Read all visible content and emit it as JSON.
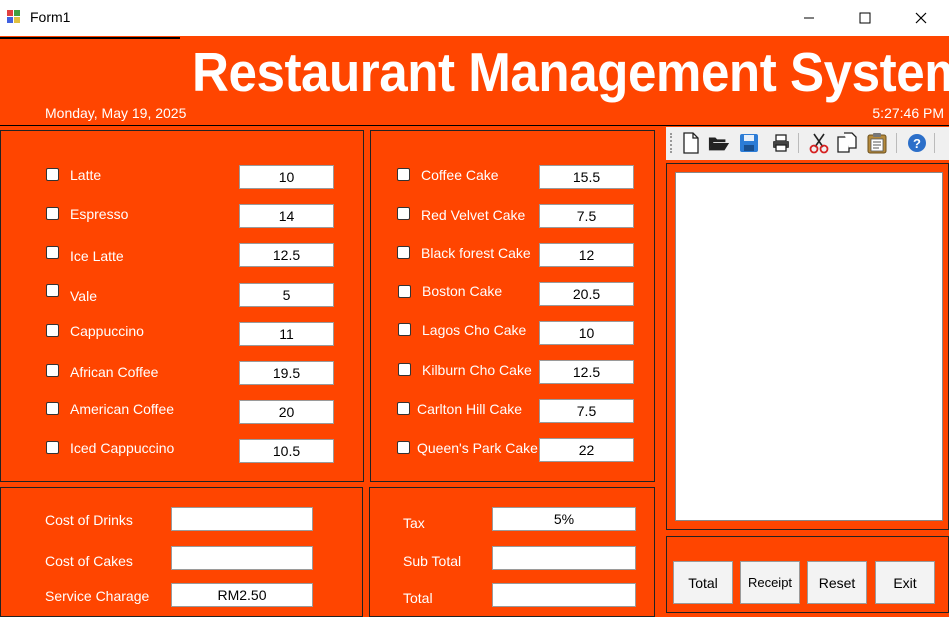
{
  "window": {
    "title": "Form1"
  },
  "header": {
    "title": "Restaurant Management System",
    "date": "Monday, May 19, 2025",
    "time": "5:27:46 PM"
  },
  "drinks": [
    {
      "label": "Latte",
      "price": "10"
    },
    {
      "label": "Espresso",
      "price": "14"
    },
    {
      "label": "Ice Latte",
      "price": "12.5"
    },
    {
      "label": "Vale",
      "price": "5"
    },
    {
      "label": "Cappuccino",
      "price": "11"
    },
    {
      "label": "African Coffee",
      "price": "19.5"
    },
    {
      "label": "American Coffee",
      "price": "20"
    },
    {
      "label": "Iced Cappuccino",
      "price": "10.5"
    }
  ],
  "cakes": [
    {
      "label": "Coffee Cake",
      "price": "15.5"
    },
    {
      "label": "Red Velvet Cake",
      "price": "7.5"
    },
    {
      "label": "Black forest Cake",
      "price": "12"
    },
    {
      "label": "Boston Cake",
      "price": "20.5"
    },
    {
      "label": "Lagos Cho Cake",
      "price": "10"
    },
    {
      "label": "Kilburn Cho Cake",
      "price": "12.5"
    },
    {
      "label": "Carlton Hill Cake",
      "price": "7.5"
    },
    {
      "label": "Queen's Park Cake",
      "price": "22"
    }
  ],
  "costs": {
    "drinks_label": "Cost of Drinks",
    "drinks_value": "",
    "cakes_label": "Cost of Cakes",
    "cakes_value": "",
    "service_label": "Service Charage",
    "service_value": "RM2.50"
  },
  "totals": {
    "tax_label": "Tax",
    "tax_value": "5%",
    "subtotal_label": "Sub Total",
    "subtotal_value": "",
    "total_label": "Total",
    "total_value": ""
  },
  "buttons": {
    "total": "Total",
    "receipt": "Receipt",
    "reset": "Reset",
    "exit": "Exit"
  },
  "toolbar_icons": [
    "new-file-icon",
    "open-folder-icon",
    "save-icon",
    "print-icon",
    "cut-icon",
    "copy-icon",
    "paste-icon",
    "help-icon"
  ]
}
